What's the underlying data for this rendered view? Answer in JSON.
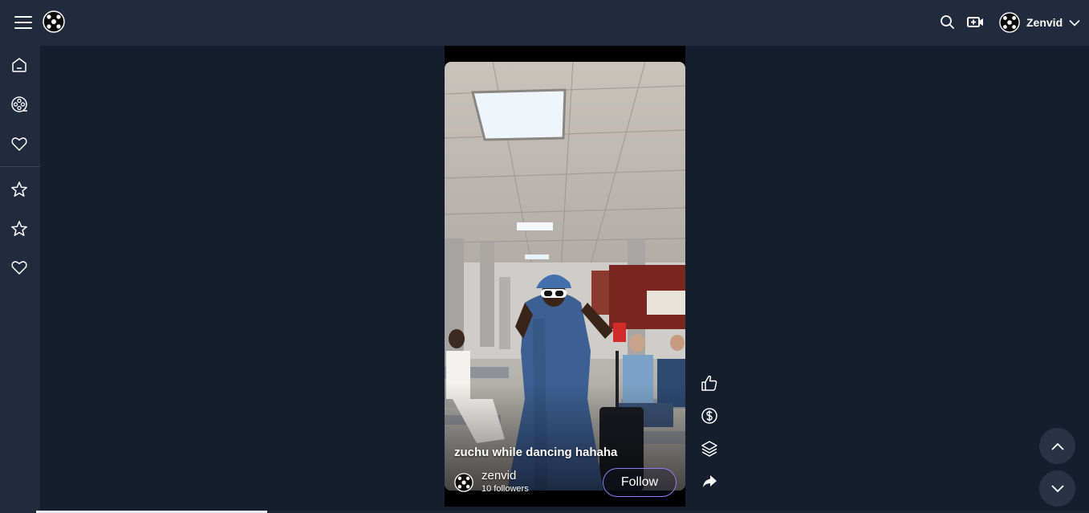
{
  "header": {
    "account_name": "Zenvid",
    "icons": [
      "menu-icon",
      "logo-icon",
      "search-icon",
      "video-camera-icon",
      "chevron-down-icon"
    ]
  },
  "sidebar": {
    "items": [
      {
        "icon": "home-icon"
      },
      {
        "icon": "film-reel-icon"
      },
      {
        "icon": "heart-icon"
      },
      {
        "icon": "star-icon"
      },
      {
        "icon": "star-icon"
      },
      {
        "icon": "heart-icon"
      }
    ]
  },
  "video": {
    "caption": "zuchu while dancing hahaha",
    "creator": {
      "name": "zenvid",
      "followers": "10 followers"
    },
    "follow_label": "Follow"
  },
  "actions": [
    "like-icon",
    "tip-dollar-icon",
    "layers-icon",
    "share-icon"
  ],
  "navigation": [
    "chevron-up-icon",
    "chevron-down-icon"
  ],
  "colors": {
    "background": "#161d2e",
    "bar": "#222b3d",
    "accent": "#8f7cf2"
  }
}
